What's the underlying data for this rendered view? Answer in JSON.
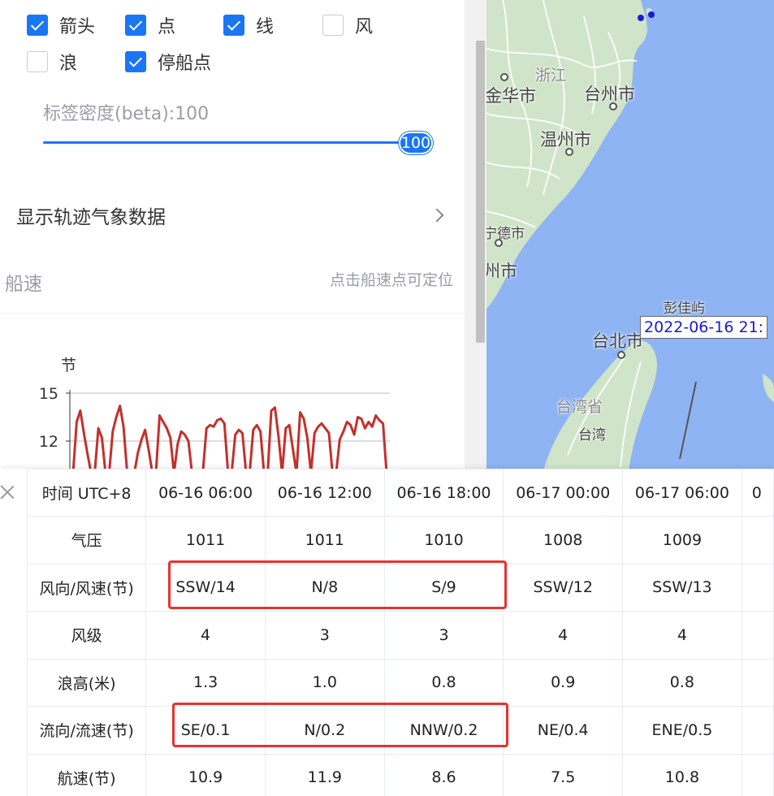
{
  "layers": {
    "arrow": {
      "label": "箭头",
      "checked": true
    },
    "point": {
      "label": "点",
      "checked": true
    },
    "line": {
      "label": "线",
      "checked": true
    },
    "wind": {
      "label": "风",
      "checked": false
    },
    "wave": {
      "label": "浪",
      "checked": false
    },
    "anchorage": {
      "label": "停船点",
      "checked": true
    }
  },
  "label_density": {
    "label": "标签密度(beta):100",
    "value": 100,
    "value_text": "100",
    "max": 100
  },
  "weather_toggle": {
    "label": "显示轨迹气象数据"
  },
  "speed_section": {
    "title": "船速",
    "hint": "点击船速点可定位"
  },
  "chart_data": {
    "type": "line",
    "title": "",
    "ylabel": "节",
    "yticks": [
      "15",
      "12"
    ],
    "ylim": [
      10,
      15.5
    ],
    "color": "#c4302b",
    "series": [
      {
        "values": [
          10,
          13.2,
          13.9,
          12.5,
          11.2,
          10,
          10,
          12.8,
          12.2,
          10,
          10,
          12.6,
          13.5,
          14.2,
          12.9,
          10,
          10,
          10,
          11.3,
          12.1,
          12.7,
          11.4,
          10,
          10,
          13.6,
          13.2,
          12.8,
          12.2,
          10,
          11.8,
          12.6,
          12.4,
          12.0,
          10,
          10,
          10,
          10,
          12.8,
          13.0,
          12.9,
          13.3,
          13.4,
          13.1,
          10,
          10,
          12.4,
          12.7,
          12.5,
          10,
          10,
          12.7,
          13.0,
          12.6,
          10,
          10,
          13.9,
          14.1,
          12.3,
          10,
          12.8,
          13.0,
          11.5,
          10,
          13.8,
          13.4,
          12.2,
          10,
          12.5,
          12.9,
          13.1,
          12.8,
          12.5,
          10,
          10,
          12.1,
          12.6,
          13.2,
          13.0,
          12.4,
          13.5,
          13.4,
          12.8,
          13.2,
          12.9,
          13.6,
          13.3,
          13.1,
          10
        ]
      }
    ]
  },
  "map": {
    "labels": {
      "zhejiang": "浙江",
      "jinhua": "金华市",
      "taizhou": "台州市",
      "wenzhou": "温州市",
      "ningde": "宁德市",
      "fuzhou": "州市",
      "pengjia": "彭佳屿",
      "taipei": "台北市",
      "taiwan_province": "台湾省",
      "taiwan": "台湾"
    },
    "ship_tag": "2022-06-16 21:",
    "colors": {
      "sea": "#8fb4f4",
      "land": "#cfe4c8",
      "track": "#1a1ad6"
    }
  },
  "weather_table": {
    "header": "时间 UTC+8",
    "times": [
      "06-16 06:00",
      "06-16 12:00",
      "06-16 18:00",
      "06-17 00:00",
      "06-17 06:00",
      "0"
    ],
    "rows": [
      {
        "label": "气压",
        "values": [
          "1011",
          "1011",
          "1010",
          "1008",
          "1009",
          ""
        ]
      },
      {
        "label": "风向/风速(节)",
        "values": [
          "SSW/14",
          "N/8",
          "S/9",
          "SSW/12",
          "SSW/13",
          ""
        ]
      },
      {
        "label": "风级",
        "values": [
          "4",
          "3",
          "3",
          "4",
          "4",
          ""
        ]
      },
      {
        "label": "浪高(米)",
        "values": [
          "1.3",
          "1.0",
          "0.8",
          "0.9",
          "0.8",
          ""
        ]
      },
      {
        "label": "流向/流速(节)",
        "values": [
          "SE/0.1",
          "N/0.2",
          "NNW/0.2",
          "NE/0.4",
          "ENE/0.5",
          ""
        ]
      },
      {
        "label": "航速(节)",
        "values": [
          "10.9",
          "11.9",
          "8.6",
          "7.5",
          "10.8",
          ""
        ]
      }
    ],
    "highlight_color": "#e8322f"
  }
}
